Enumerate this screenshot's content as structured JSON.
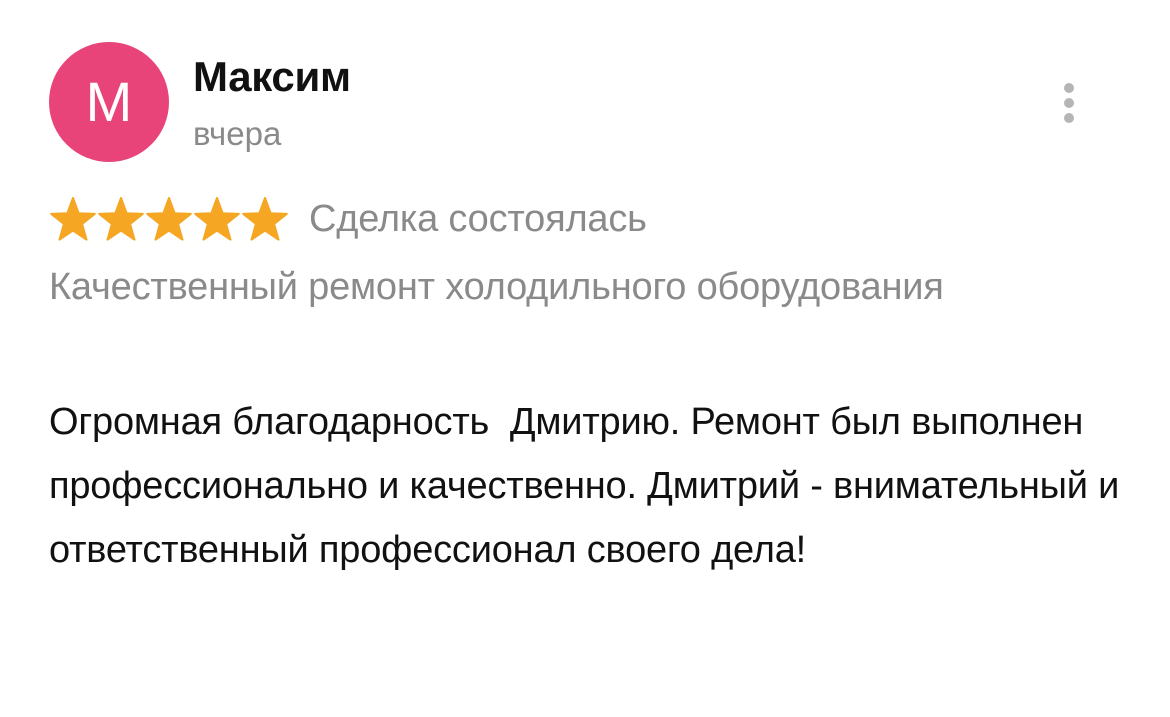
{
  "review": {
    "avatar_letter": "М",
    "avatar_color": "#e8447a",
    "author_name": "Максим",
    "date": "вчера",
    "rating": 5,
    "rating_max": 5,
    "star_color": "#f5a623",
    "deal_status": "Сделка состоялась",
    "service": "Качественный ремонт холодильного оборудования",
    "text": "Огромная благодарность  Дмитрию. Ремонт был выполнен профессионально и качественно. Дмитрий - внимательный и ответственный профессионал своего дела!",
    "menu_icon": "more-vertical-icon"
  }
}
